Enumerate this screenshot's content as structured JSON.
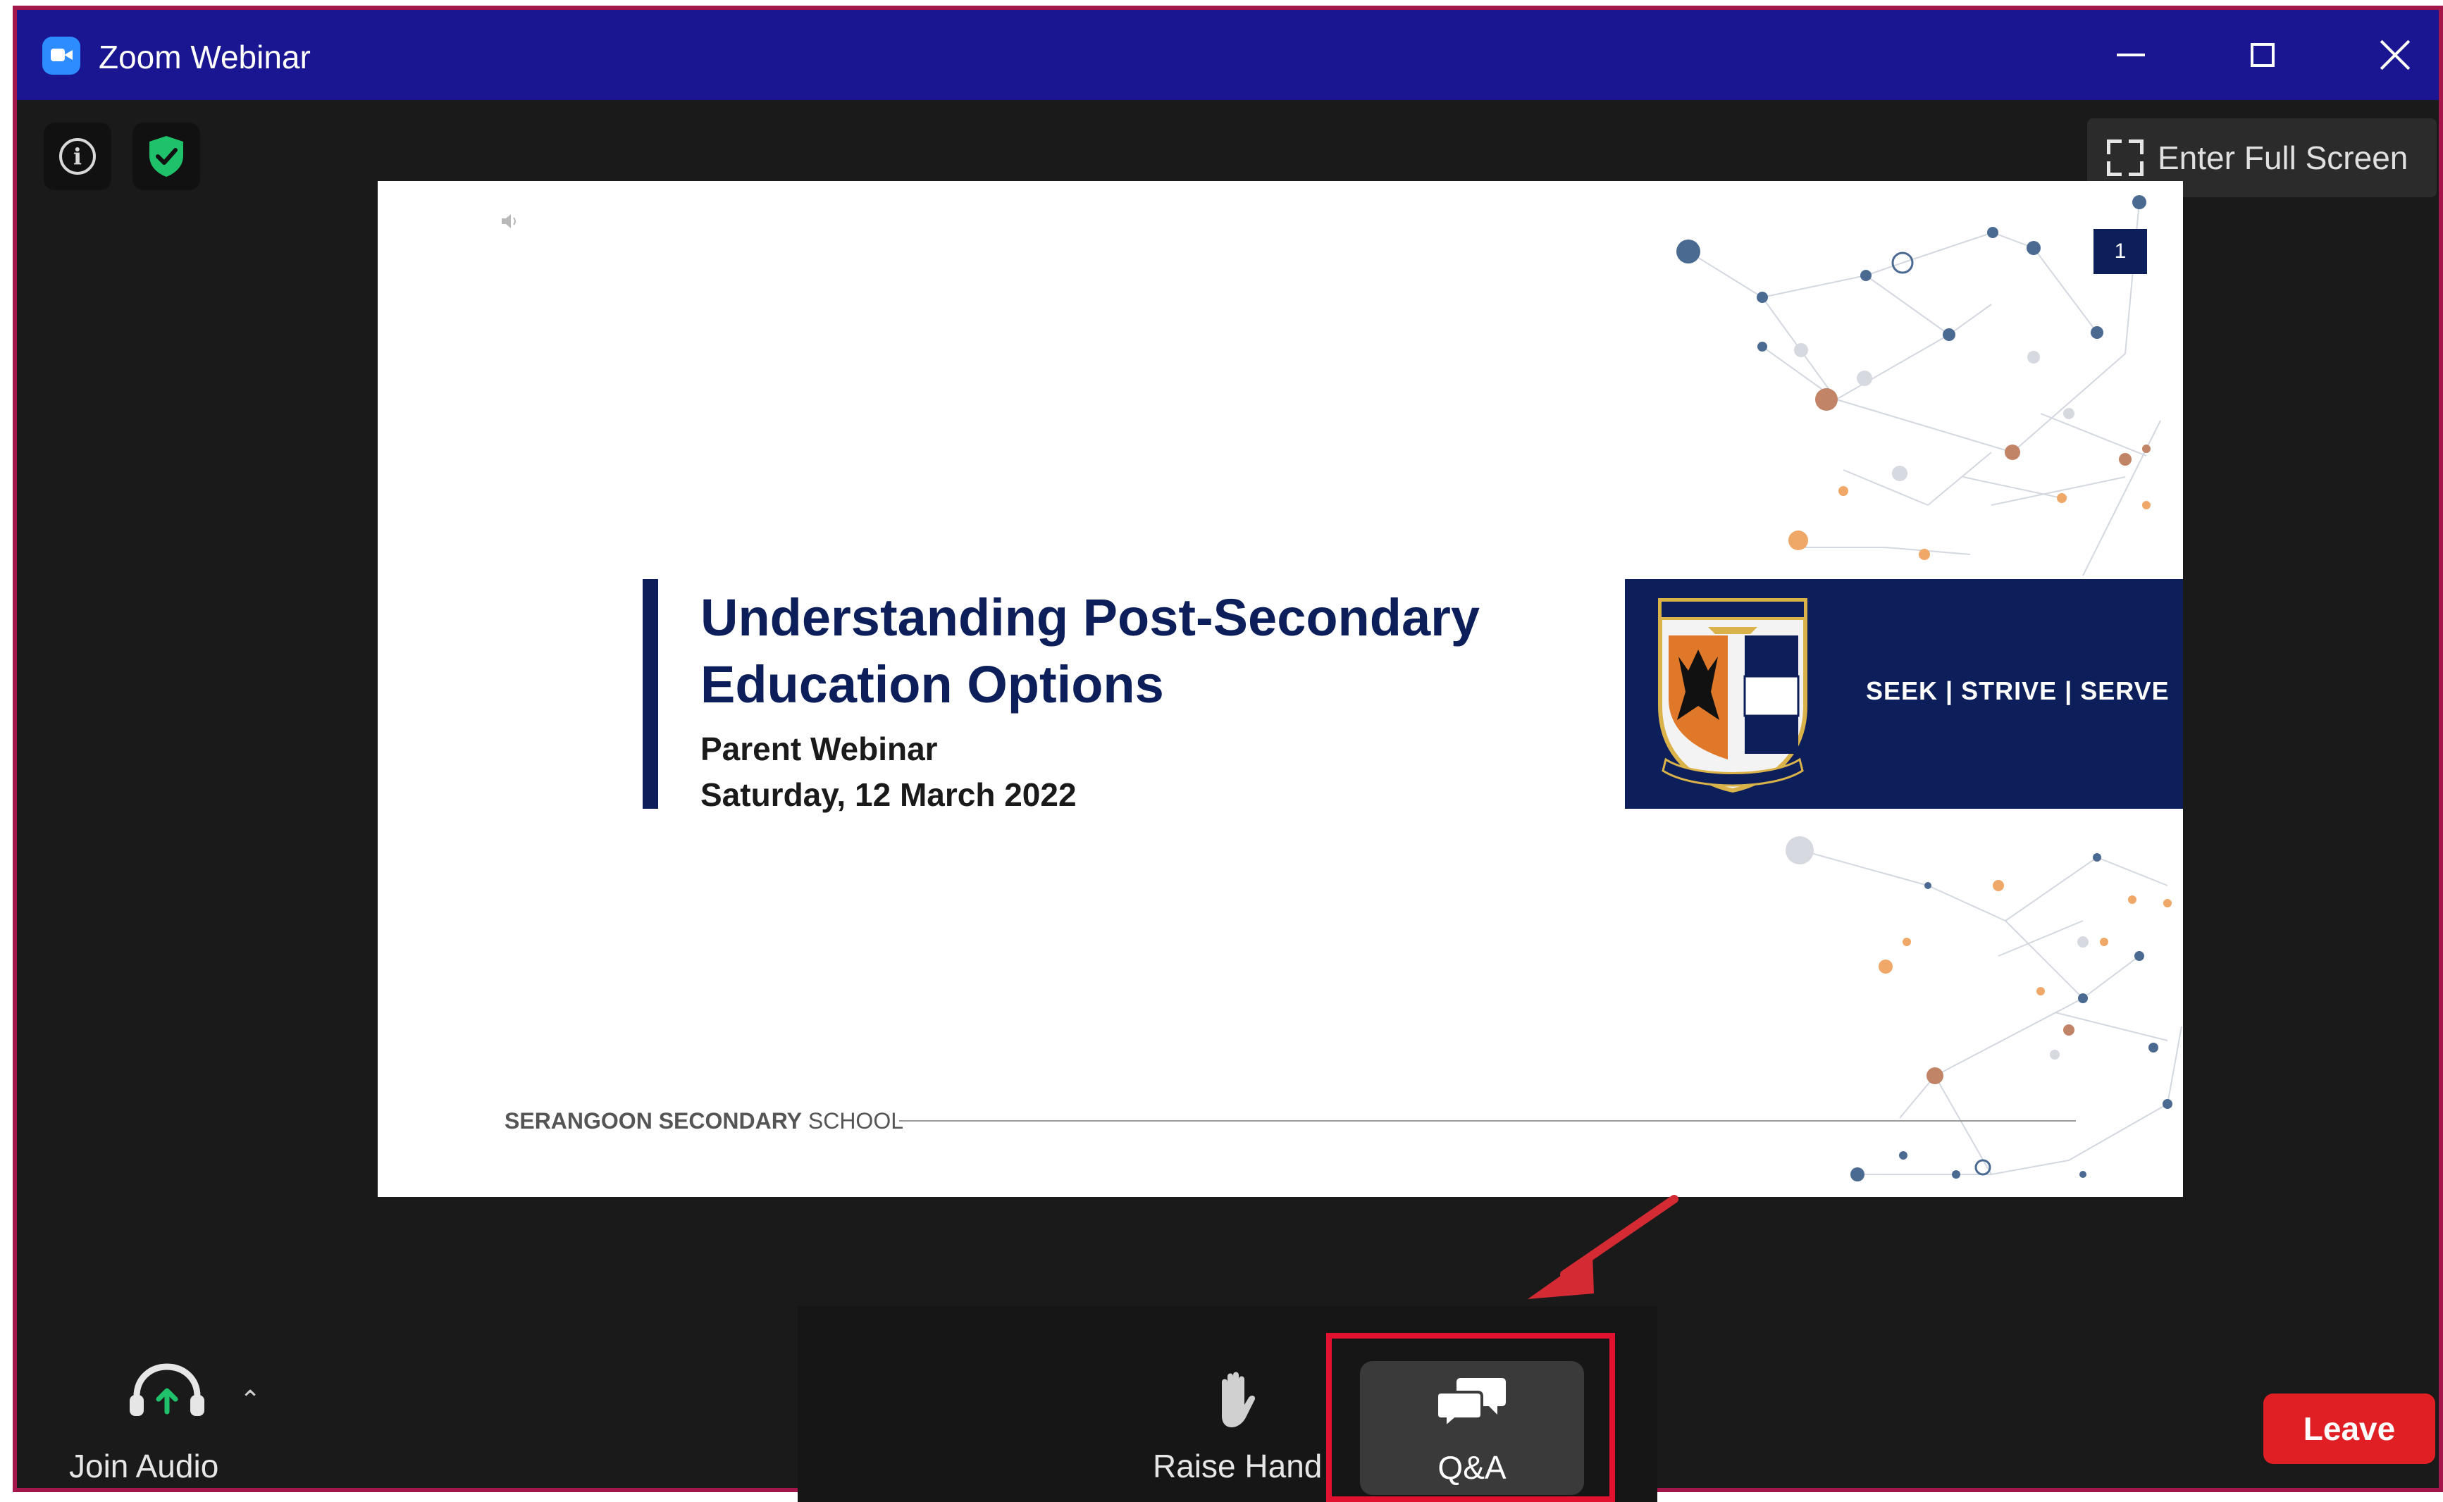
{
  "window": {
    "title": "Zoom Webinar"
  },
  "topbar": {
    "fullscreen_label": "Enter Full Screen"
  },
  "slide": {
    "title_line1": "Understanding Post-Secondary",
    "title_line2": "Education Options",
    "subtitle": "Parent Webinar",
    "date": "Saturday, 12 March 2022",
    "page_number": "1",
    "motto": "SEEK | STRIVE | SERVE",
    "footer_bold": "SERANGOON SECONDARY",
    "footer_light": "SCHOOL",
    "crest_text": "SERANGOON SECONDARY SCHOOL · SEEK STRIVE SERVE"
  },
  "toolbar": {
    "join_audio_label": "Join Audio",
    "raise_hand_label": "Raise Hand",
    "qa_label": "Q&A",
    "leave_label": "Leave"
  },
  "colors": {
    "titlebar": "#1a1590",
    "frame_border": "#a3174a",
    "slide_navy": "#0d1f5a",
    "highlight_red": "#e0122f",
    "leave_red": "#df1f24",
    "shield_green": "#1fc16b"
  }
}
